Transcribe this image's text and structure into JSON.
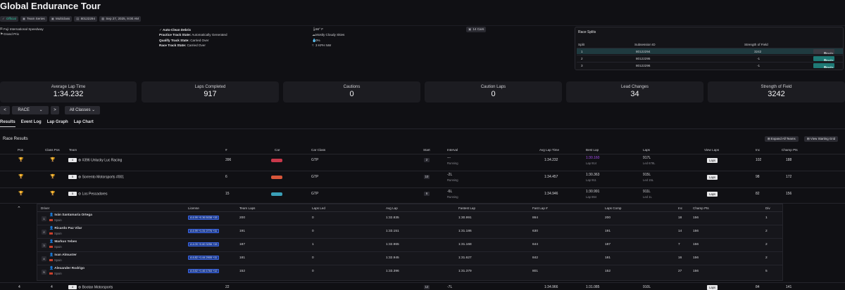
{
  "header": {
    "title": "Global Endurance Tour",
    "badges": [
      {
        "icon": "check-icon",
        "label": "Official"
      },
      {
        "icon": "team-icon",
        "label": "Team Series"
      },
      {
        "icon": "multiclass-icon",
        "label": "Multiclass"
      },
      {
        "icon": "id-icon",
        "label": "80122294"
      },
      {
        "icon": "calendar-icon",
        "label": "Sep 27, 2025, 9:00 AM"
      }
    ]
  },
  "session_info": {
    "track": "Fuji International Speedway",
    "layout": "Grand Prix",
    "auto_clean": "Auto-Clean Debris",
    "practice_label": "Practice Track State:",
    "practice_value": "Automatically Generated",
    "qualify_label": "Qualify Track State:",
    "qualify_value": "Carried Over",
    "race_label": "Race Track State:",
    "race_value": "Carried Over",
    "temp": "66° F",
    "sky": "Mostly Cloudy Skies",
    "humidity": "0%",
    "wind": "3 KPH NW",
    "cars": "14 Cars"
  },
  "splits": {
    "title": "Race Splits",
    "headers": [
      "Split",
      "Subsession ID",
      "Strength of Field"
    ],
    "rows": [
      {
        "split": "1",
        "id": "80122294",
        "sof": "3242",
        "btn": "Results"
      },
      {
        "split": "2",
        "id": "80122295",
        "sof": "-1",
        "btn": "Results"
      },
      {
        "split": "3",
        "id": "80122296",
        "sof": "-1",
        "btn": "Results"
      }
    ]
  },
  "stats": [
    {
      "label": "Average Lap Time",
      "value": "1:34.232"
    },
    {
      "label": "Laps Completed",
      "value": "917"
    },
    {
      "label": "Cautions",
      "value": "0"
    },
    {
      "label": "Caution Laps",
      "value": "0"
    },
    {
      "label": "Lead Changes",
      "value": "34"
    },
    {
      "label": "Strength of Field",
      "value": "3242"
    }
  ],
  "controls": {
    "prev": "<",
    "session": "RACE",
    "next": ">",
    "classes": "All Classes"
  },
  "tabs": [
    "Results",
    "Event Log",
    "Lap Graph",
    "Lap Chart"
  ],
  "results": {
    "title": "Race Results",
    "expand_btn": "Expand All Teams",
    "grid_btn": "View Starting Grid",
    "headers": [
      "Pos",
      "Class Pos",
      "Team",
      "#",
      "Car",
      "Car Class",
      "Start",
      "Interval",
      "Avg Lap Time",
      "Best Lap",
      "Laps",
      "View Laps",
      "Inc",
      "Champ Pts"
    ],
    "rows": [
      {
        "drivers": "4",
        "team": "#396 Unlucky Luc Racing",
        "num": "396",
        "cls": "GTP",
        "start": "2",
        "interval": "---",
        "status": "Running",
        "avg": "1:34.232",
        "best": "1:30.160",
        "best_sub": "Lap 914",
        "laps": "917L",
        "laps_sub": "Led 678L",
        "view": "Laps",
        "inc": "102",
        "pts": "188",
        "car_color": "#c8384a"
      },
      {
        "drivers": "5",
        "team": "Sorrento Motorsports #001",
        "num": "6",
        "cls": "GTP",
        "start": "10",
        "interval": "-2L",
        "status": "Running",
        "avg": "1:34.457",
        "best": "1:30.363",
        "best_sub": "Lap 911",
        "laps": "915L",
        "laps_sub": "Led 15L",
        "view": "Laps",
        "inc": "98",
        "pts": "172",
        "car_color": "#d8563a"
      },
      {
        "drivers": "5",
        "team": "Los Pescadores",
        "num": "15",
        "cls": "GTP",
        "start": "6",
        "interval": "-6L",
        "status": "Running",
        "avg": "1:34.946",
        "best": "1:30.991",
        "best_sub": "Lap 864",
        "laps": "911L",
        "laps_sub": "Led 1L",
        "view": "Laps",
        "inc": "82",
        "pts": "156",
        "car_color": "#3aa0b8"
      }
    ]
  },
  "drivers": {
    "headers": [
      "Driver",
      "License",
      "Team Laps",
      "Laps Led",
      "Avg Lap",
      "Fastest Lap",
      "Fast Lap #",
      "Laps Comp",
      "Inc",
      "Champ Pts",
      "Div"
    ],
    "rows": [
      {
        "pos": "1",
        "name": "Iván Santamaría Ortega",
        "country": "Spain",
        "lic": "A 4.99 +0.36 5038 +15",
        "team_laps": "200",
        "led": "0",
        "avg": "1:32.835",
        "fast": "1:30.991",
        "fast_no": "864",
        "comp": "200",
        "inc": "18",
        "pts": "156",
        "div": "1"
      },
      {
        "pos": "2",
        "name": "Ricardo Paz Vilar",
        "country": "Spain",
        "lic": "A 4.99 +1.31 2776 +11",
        "team_laps": "191",
        "led": "0",
        "avg": "1:33.151",
        "fast": "1:31.186",
        "fast_no": "630",
        "comp": "191",
        "inc": "14",
        "pts": "156",
        "div": "2"
      },
      {
        "pos": "3",
        "name": "Markus Yebes",
        "country": "Spain",
        "lic": "A 4.09 +0.60 3256 +15",
        "team_laps": "187",
        "led": "1",
        "avg": "1:32.965",
        "fast": "1:31.168",
        "fast_no": "644",
        "comp": "187",
        "inc": "7",
        "pts": "156",
        "div": "2"
      },
      {
        "pos": "4",
        "name": "Ivan Almuster",
        "country": "Spain",
        "lic": "A 4.82 +1.44 2905 +11",
        "team_laps": "181",
        "led": "0",
        "avg": "1:32.945",
        "fast": "1:31.627",
        "fast_no": "842",
        "comp": "181",
        "inc": "16",
        "pts": "156",
        "div": "2"
      },
      {
        "pos": "5",
        "name": "Alexander Rodrigo",
        "country": "Spain",
        "lic": "A 3.52 +1.46 1763 +12",
        "team_laps": "152",
        "led": "0",
        "avg": "1:33.396",
        "fast": "1:31.379",
        "fast_no": "801",
        "comp": "152",
        "inc": "27",
        "pts": "156",
        "div": "5"
      }
    ]
  },
  "bottom_row": {
    "pos": "4",
    "cpos": "4",
    "team": "Bootan Motorsports",
    "num": "22",
    "start": "12",
    "interval": "-7L",
    "avg": "1:34.966",
    "best": "1:31.085",
    "laps": "910L",
    "view": "Laps",
    "inc": "84",
    "pts": "141"
  }
}
